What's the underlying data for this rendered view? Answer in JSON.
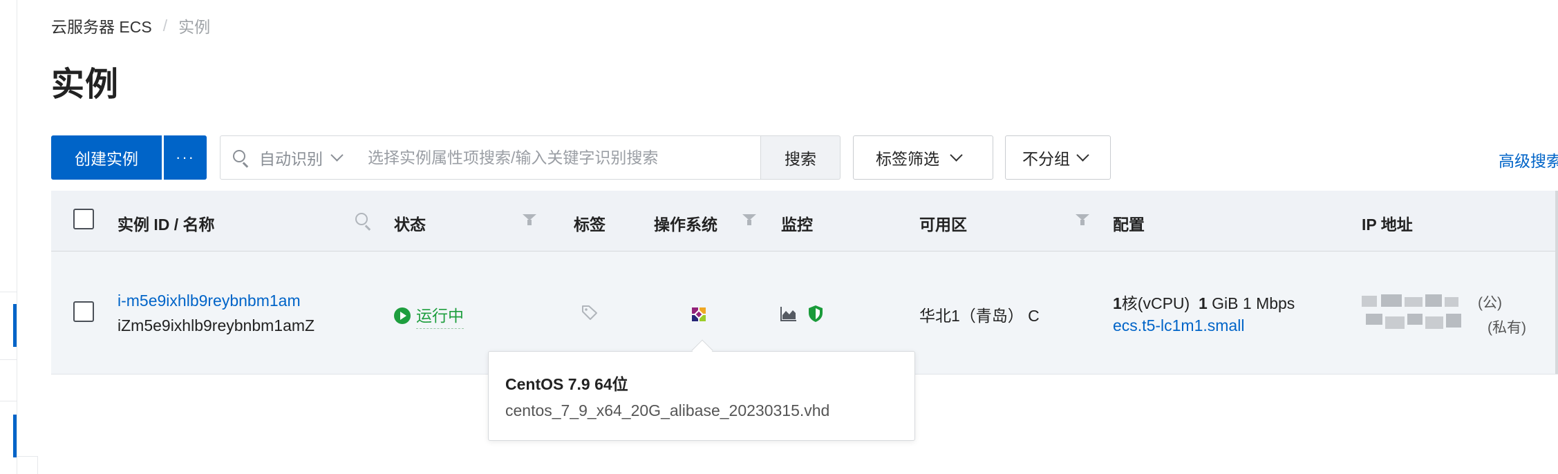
{
  "breadcrumb": {
    "parent": "云服务器 ECS",
    "separator": "/",
    "current": "实例"
  },
  "page_title": "实例",
  "toolbar": {
    "create_label": "创建实例",
    "more_label": "···",
    "search_mode": "自动识别",
    "search_placeholder": "选择实例属性项搜索/输入关键字识别搜索",
    "search_button": "搜索",
    "tag_filter": "标签筛选",
    "group_select": "不分组",
    "advanced_search": "高级搜索"
  },
  "table": {
    "columns": {
      "id_name": "实例 ID / 名称",
      "status": "状态",
      "tags": "标签",
      "os": "操作系统",
      "monitor": "监控",
      "zone": "可用区",
      "config": "配置",
      "ip": "IP 地址"
    },
    "rows": [
      {
        "instance_id": "i-m5e9ixhlb9reybnbm1am",
        "name": "iZm5e9ixhlb9reybnbm1amZ",
        "status": "运行中",
        "zone": "华北1（青岛） C",
        "config_cpu_count": "1",
        "config_cpu_unit": "核(vCPU)",
        "config_mem_count": "1",
        "config_mem_unit": "GiB 1 Mbps",
        "instance_type": "ecs.t5-lc1m1.small",
        "ip_public_suffix": "(公)",
        "ip_private_suffix": "(私有)"
      }
    ]
  },
  "os_tooltip": {
    "title": "CentOS 7.9 64位",
    "image": "centos_7_9_x64_20G_alibase_20230315.vhd"
  },
  "icons": {
    "search": "search-icon",
    "filter": "filter-icon",
    "tag": "tag-icon",
    "os": "centos-logo-icon",
    "monitor_chart": "area-chart-icon",
    "security_shield": "shield-icon"
  },
  "colors": {
    "primary": "#0064c8",
    "running": "#1e9e3e",
    "shield": "#1a9b3a"
  }
}
